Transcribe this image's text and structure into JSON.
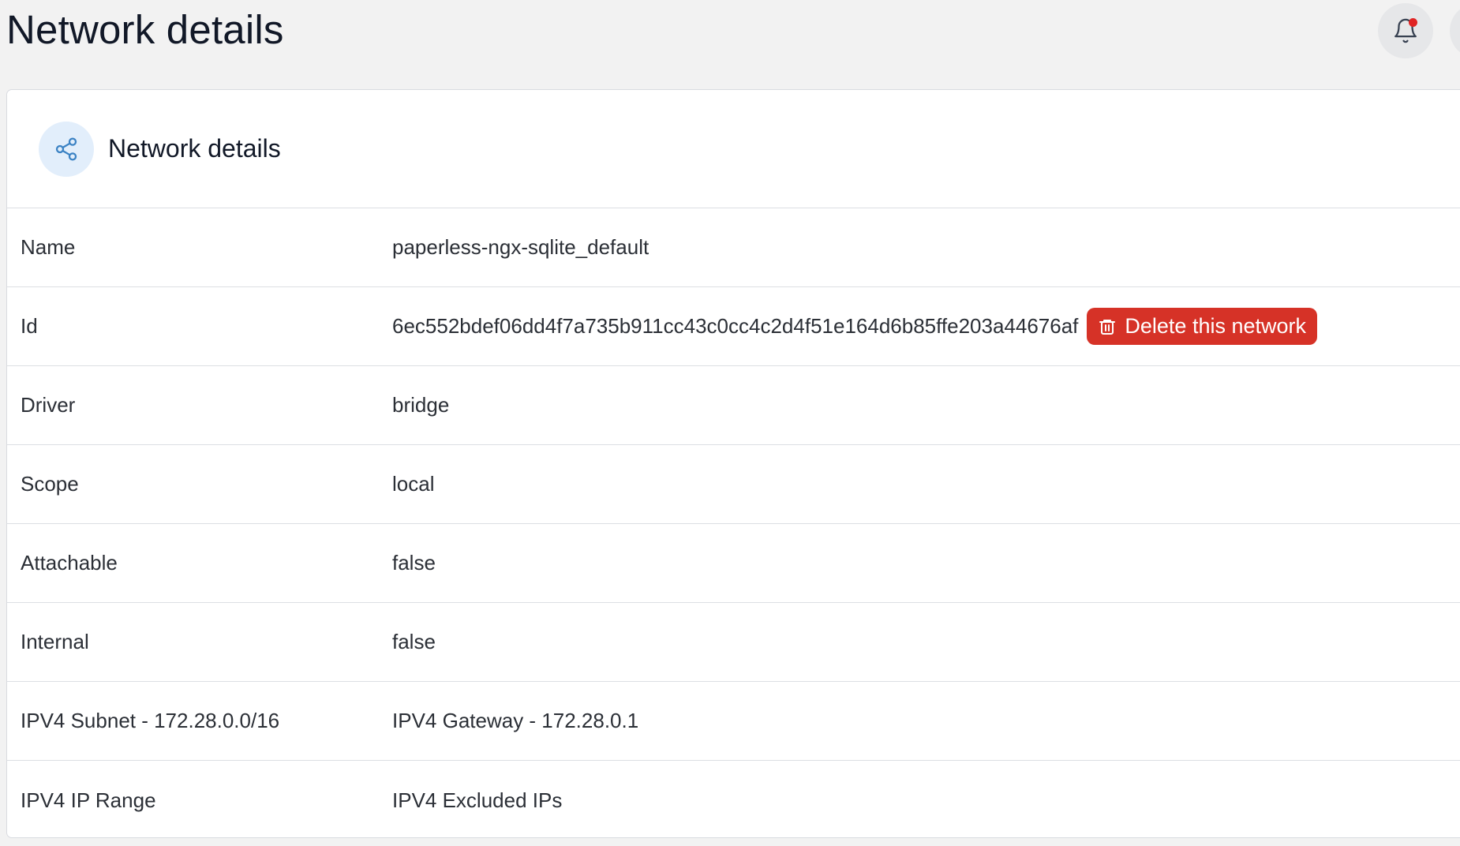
{
  "page": {
    "title": "Network details"
  },
  "header": {
    "notifications_icon": "bell-icon",
    "has_unread_notifications": true,
    "user_icon": "user-avatar-icon"
  },
  "card": {
    "icon": "share-network-icon",
    "title": "Network details"
  },
  "details": [
    {
      "key": "Name",
      "value": "paperless-ngx-sqlite_default"
    },
    {
      "key": "Id",
      "value": "6ec552bdef06dd4f7a735b911cc43c0cc4c2d4f51e164d6b85ffe203a44676af",
      "action_label": "Delete this network",
      "action_icon": "trash-icon"
    },
    {
      "key": "Driver",
      "value": "bridge"
    },
    {
      "key": "Scope",
      "value": "local"
    },
    {
      "key": "Attachable",
      "value": "false"
    },
    {
      "key": "Internal",
      "value": "false"
    },
    {
      "key": "IPV4 Subnet - 172.28.0.0/16",
      "value": "IPV4 Gateway - 172.28.0.1"
    },
    {
      "key": "IPV4 IP Range",
      "value": "IPV4 Excluded IPs"
    }
  ],
  "colors": {
    "background": "#f2f2f2",
    "card": "#ffffff",
    "accent": "#3b82c4",
    "danger": "#d63227",
    "notification_dot": "#e02424"
  }
}
